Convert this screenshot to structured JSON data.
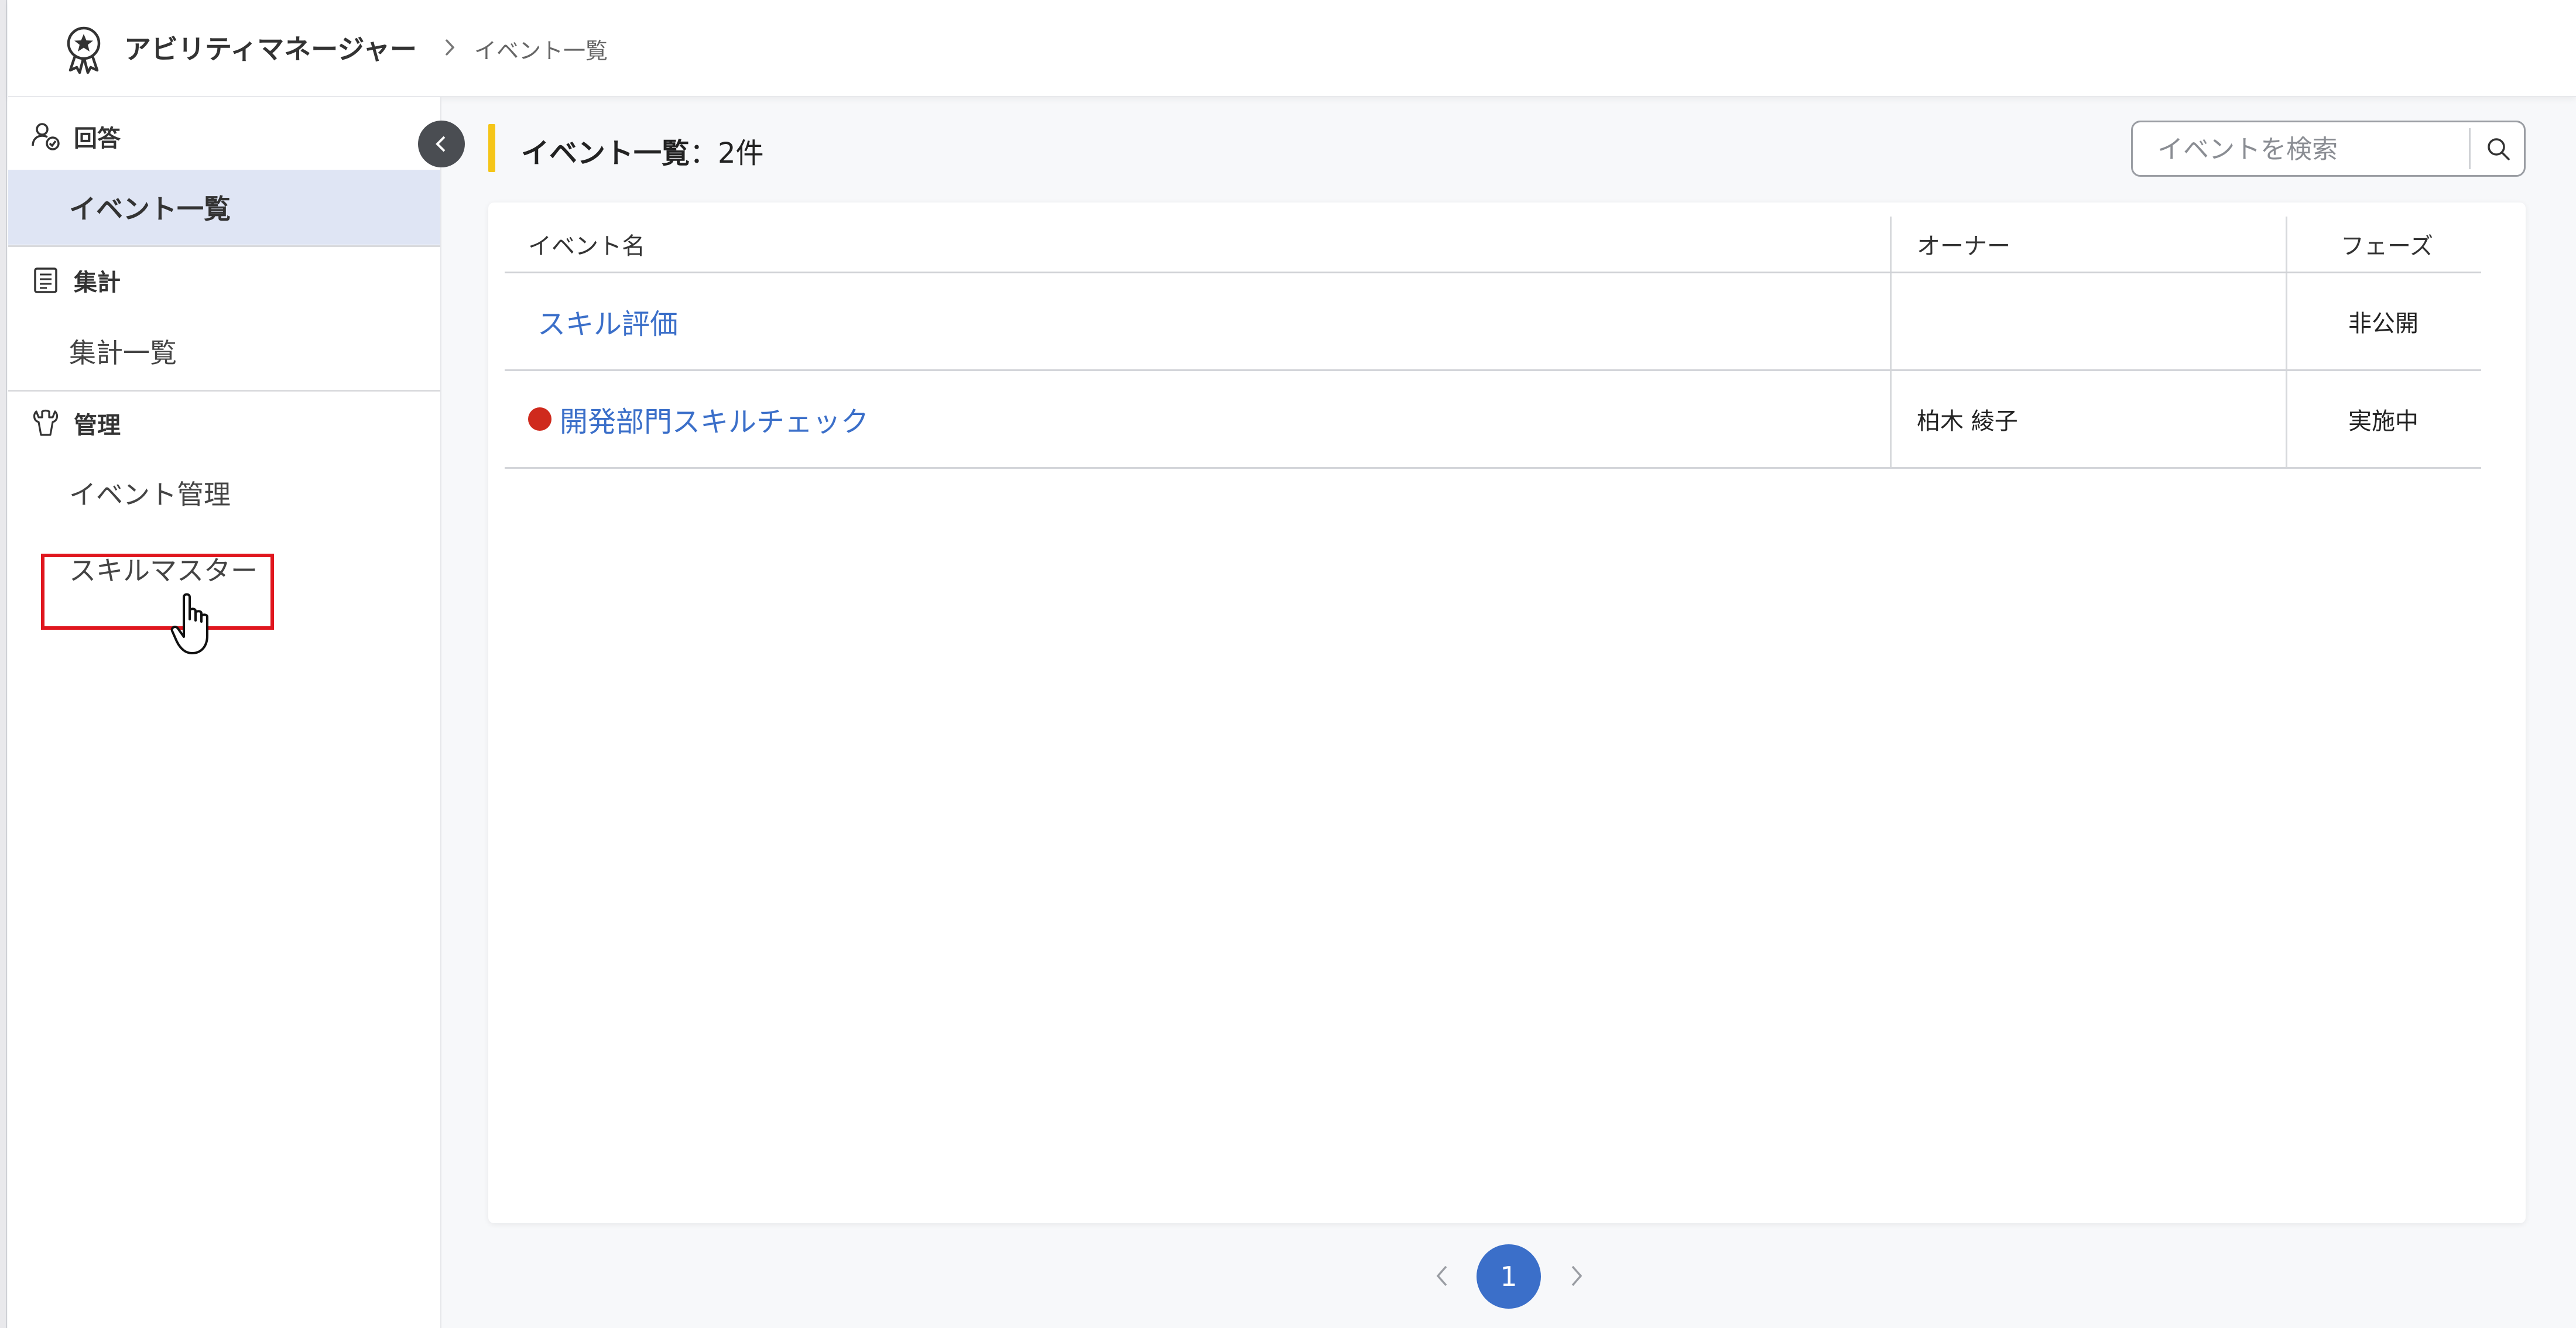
{
  "header": {
    "app_title": "アビリティマネージャー",
    "breadcrumb_current": "イベント一覧"
  },
  "sidebar": {
    "sections": [
      {
        "title": "回答",
        "icon": "person-check-icon",
        "items": [
          {
            "label": "イベント一覧",
            "active": true
          }
        ]
      },
      {
        "title": "集計",
        "icon": "list-document-icon",
        "items": [
          {
            "label": "集計一覧",
            "active": false
          }
        ]
      },
      {
        "title": "管理",
        "icon": "wrench-icon",
        "items": [
          {
            "label": "イベント管理",
            "active": false
          },
          {
            "label": "スキルマスター",
            "active": false
          }
        ]
      }
    ]
  },
  "main": {
    "title": "イベント一覧",
    "count_text": "：2件",
    "search": {
      "placeholder": "イベントを検索"
    },
    "table": {
      "columns": [
        "イベント名",
        "オーナー",
        "フェーズ"
      ],
      "rows": [
        {
          "name": "スキル評価",
          "owner": "",
          "phase": "非公開",
          "status_dot": false
        },
        {
          "name": "開発部門スキルチェック",
          "owner": "柏木 綾子",
          "phase": "実施中",
          "status_dot": true
        }
      ]
    },
    "pagination": {
      "current_page": "1"
    }
  },
  "colors": {
    "accent_yellow": "#f5c518",
    "link_blue": "#3b6fc9",
    "active_bg": "#dfe5f4",
    "status_red": "#cf2a1d",
    "highlight_red": "#e0161e"
  }
}
